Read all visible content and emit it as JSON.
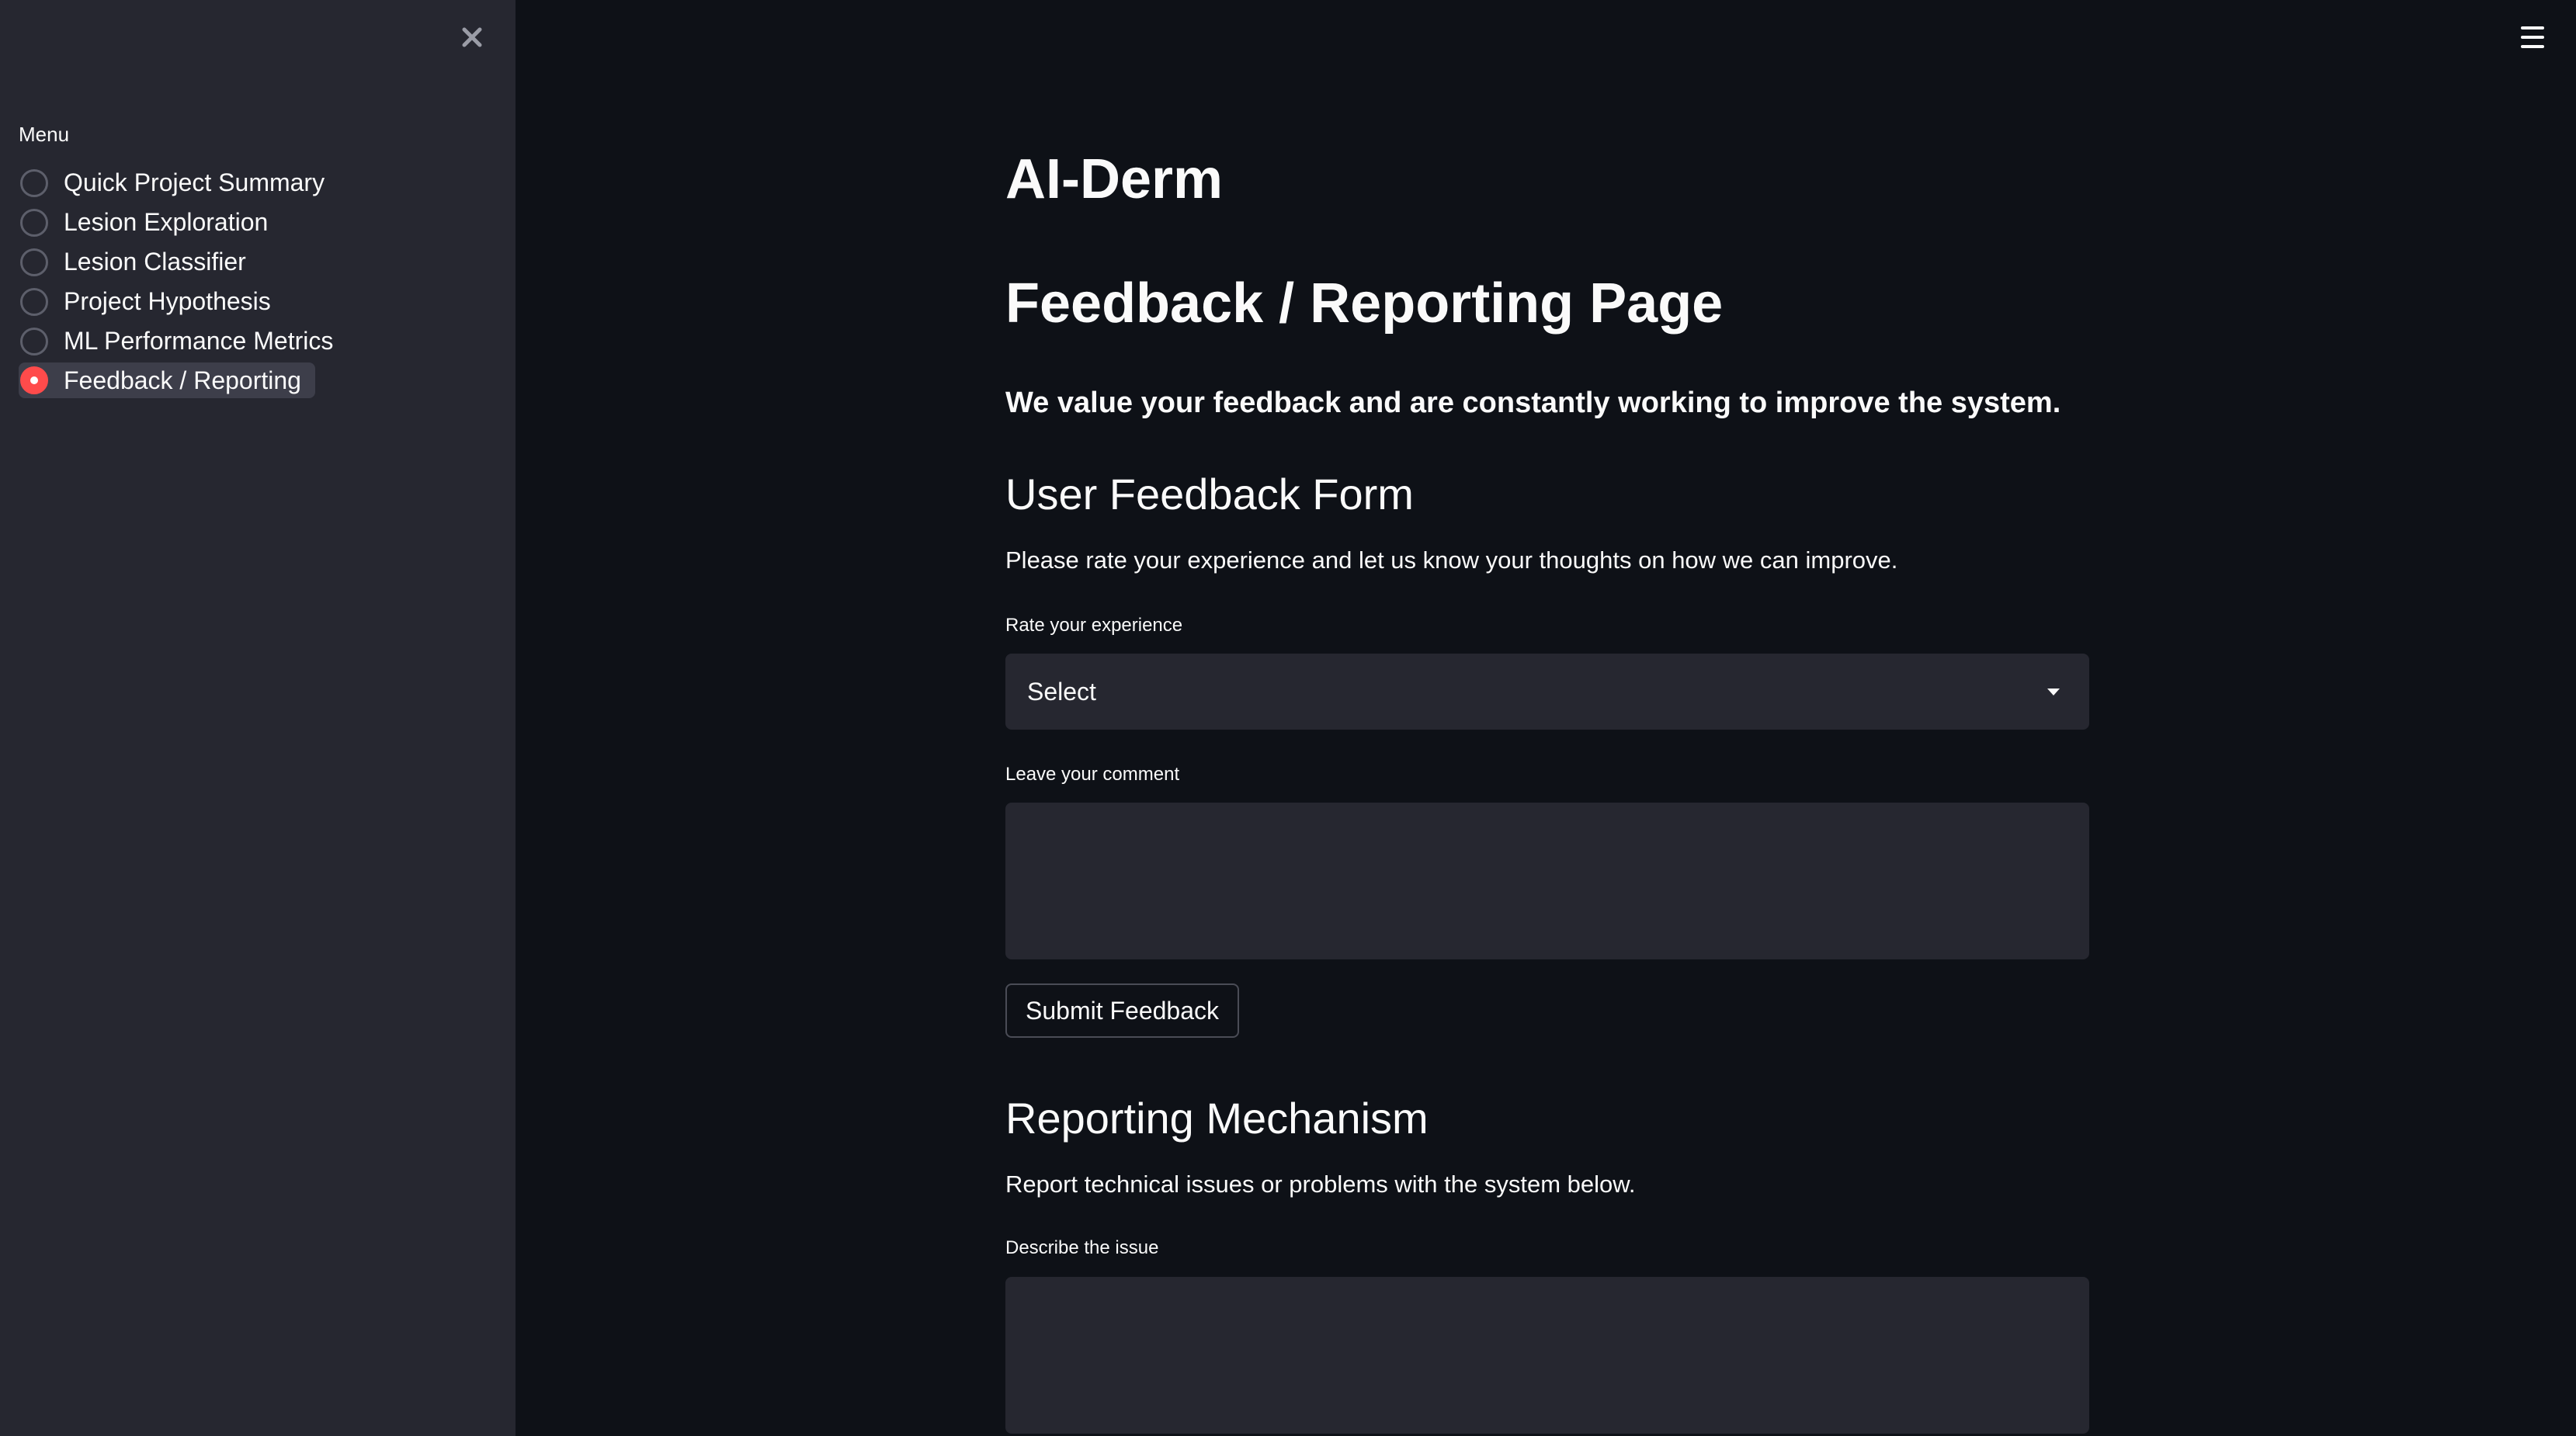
{
  "sidebar": {
    "menu_label": "Menu",
    "items": [
      {
        "label": "Quick Project Summary",
        "selected": false
      },
      {
        "label": "Lesion Exploration",
        "selected": false
      },
      {
        "label": "Lesion Classifier",
        "selected": false
      },
      {
        "label": "Project Hypothesis",
        "selected": false
      },
      {
        "label": "ML Performance Metrics",
        "selected": false
      },
      {
        "label": "Feedback / Reporting",
        "selected": true
      }
    ],
    "close_icon": "close-icon"
  },
  "header": {
    "menu_icon": "hamburger-icon"
  },
  "main": {
    "app_title": "AI-Derm",
    "page_title": "Feedback / Reporting Page",
    "intro": "We value your feedback and are constantly working to improve the system.",
    "feedback_form": {
      "heading": "User Feedback Form",
      "description": "Please rate your experience and let us know your thoughts on how we can improve.",
      "rating_label": "Rate your experience",
      "rating_value": "Select",
      "comment_label": "Leave your comment",
      "comment_value": "",
      "submit_label": "Submit Feedback"
    },
    "reporting": {
      "heading": "Reporting Mechanism",
      "description": "Report technical issues or problems with the system below.",
      "issue_label": "Describe the issue",
      "issue_value": ""
    }
  },
  "colors": {
    "background": "#0e1117",
    "sidebar": "#262730",
    "accent": "#ff4b4b",
    "text": "#fafafa"
  }
}
